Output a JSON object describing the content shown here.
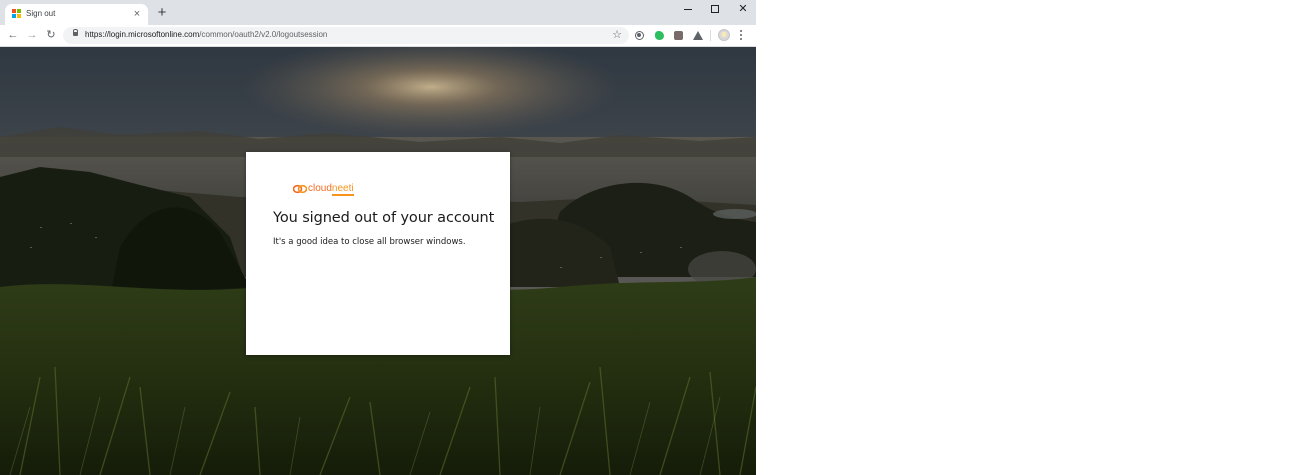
{
  "browser": {
    "tab": {
      "title": "Sign out",
      "close_glyph": "×",
      "favicon": "microsoft-logo-icon",
      "favicon_colors": [
        "#f25022",
        "#7fba00",
        "#00a4ef",
        "#ffb900"
      ]
    },
    "new_tab_glyph": "+",
    "window_controls": {
      "close_glyph": "✕"
    },
    "toolbar": {
      "back_glyph": "←",
      "forward_glyph": "→",
      "reload_glyph": "↻",
      "url_host": "https://login.microsoftonline.com",
      "url_path": "/common/oauth2/v2.0/logoutsession",
      "star_glyph": "☆"
    },
    "extensions": [
      "ext-circle-icon",
      "evernote-icon",
      "pdf-extension-icon",
      "drive-icon"
    ]
  },
  "signout_card": {
    "logo": {
      "text_main": "cloud",
      "text_accent": "neeti"
    },
    "title": "You signed out of your account",
    "description": "It's a good idea to close all browser windows."
  },
  "colors": {
    "brand_orange": "#f26b21",
    "brand_accent": "#f7941d"
  }
}
